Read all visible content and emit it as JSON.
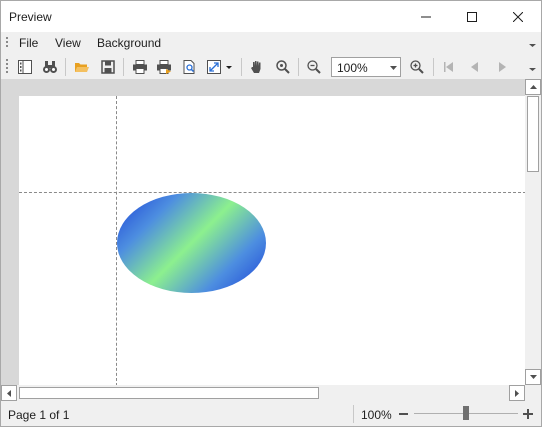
{
  "window": {
    "title": "Preview"
  },
  "menu": {
    "items": [
      "File",
      "View",
      "Background"
    ]
  },
  "toolbar": {
    "zoom_value": "100%",
    "buttons": [
      "thumbnails-icon",
      "find-icon",
      "open-icon",
      "save-icon",
      "print-icon",
      "quick-print-icon",
      "page-setup-icon",
      "scale-icon",
      "hand-icon",
      "magnifier-icon",
      "zoom-out-icon",
      "zoom-in-icon",
      "first-page-icon",
      "previous-page-icon",
      "next-page-icon"
    ]
  },
  "document": {
    "shape": "ellipse",
    "gradient_colors": [
      "#1a3fd6",
      "#8cf08e"
    ]
  },
  "status": {
    "page": "Page 1 of 1",
    "zoom": "100%",
    "zoom_slider_fraction": 0.5
  },
  "colors": {
    "accent_open": "#e8a020",
    "toolbar_icon": "#505050"
  }
}
